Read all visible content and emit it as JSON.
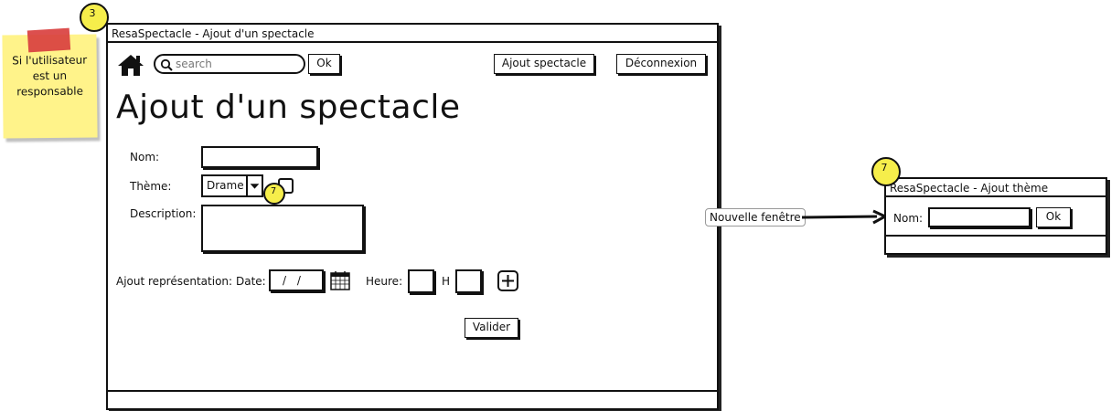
{
  "sticky_note": {
    "text": "Si l'utilisateur est un responsable",
    "badge": "3"
  },
  "main_window": {
    "title": "ResaSpectacle - Ajout d'un spectacle",
    "toolbar": {
      "search_placeholder": "search",
      "ok_label": "Ok",
      "add_show_label": "Ajout spectacle",
      "logout_label": "Déconnexion"
    },
    "page_title": "Ajout d'un spectacle",
    "form": {
      "name_label": "Nom:",
      "name_value": "",
      "theme_label": "Thème:",
      "theme_value": "Drame",
      "theme_badge": "7",
      "description_label": "Description:",
      "description_value": "",
      "representation_label": "Ajout représentation:",
      "date_label": "Date:",
      "date_value": "/ /",
      "time_label": "Heure:",
      "hour_separator": "H",
      "submit_label": "Valider"
    }
  },
  "connector": {
    "label": "Nouvelle fenêtre"
  },
  "theme_window": {
    "badge": "7",
    "title": "ResaSpectacle - Ajout thème",
    "name_label": "Nom:",
    "name_value": "",
    "ok_label": "Ok"
  },
  "icons": [
    "home-icon",
    "search-icon",
    "chevron-down-icon",
    "calendar-icon",
    "plus-icon",
    "arrow-right-icon"
  ]
}
